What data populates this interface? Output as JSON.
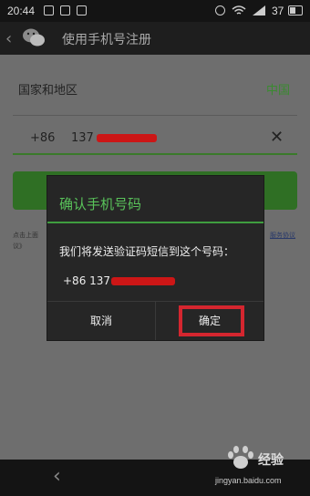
{
  "status_bar": {
    "time": "20:44",
    "battery_level": "37"
  },
  "header": {
    "title": "使用手机号注册"
  },
  "form": {
    "region_label": "国家和地区",
    "region_value": "中国",
    "country_code": "+86",
    "phone_prefix": "137",
    "agreement_left": "点击上面",
    "agreement_left2": "议》",
    "agreement_right": "服务协议"
  },
  "dialog": {
    "title": "确认手机号码",
    "message": "我们将发送验证码短信到这个号码：",
    "phone": "+86 137",
    "cancel_label": "取消",
    "confirm_label": "确定"
  },
  "watermark": {
    "text": "经验",
    "url": "jingyan.baidu.com"
  },
  "colors": {
    "accent": "#3f9d3f",
    "highlight": "#d4262f",
    "mask": "#cc1616"
  }
}
